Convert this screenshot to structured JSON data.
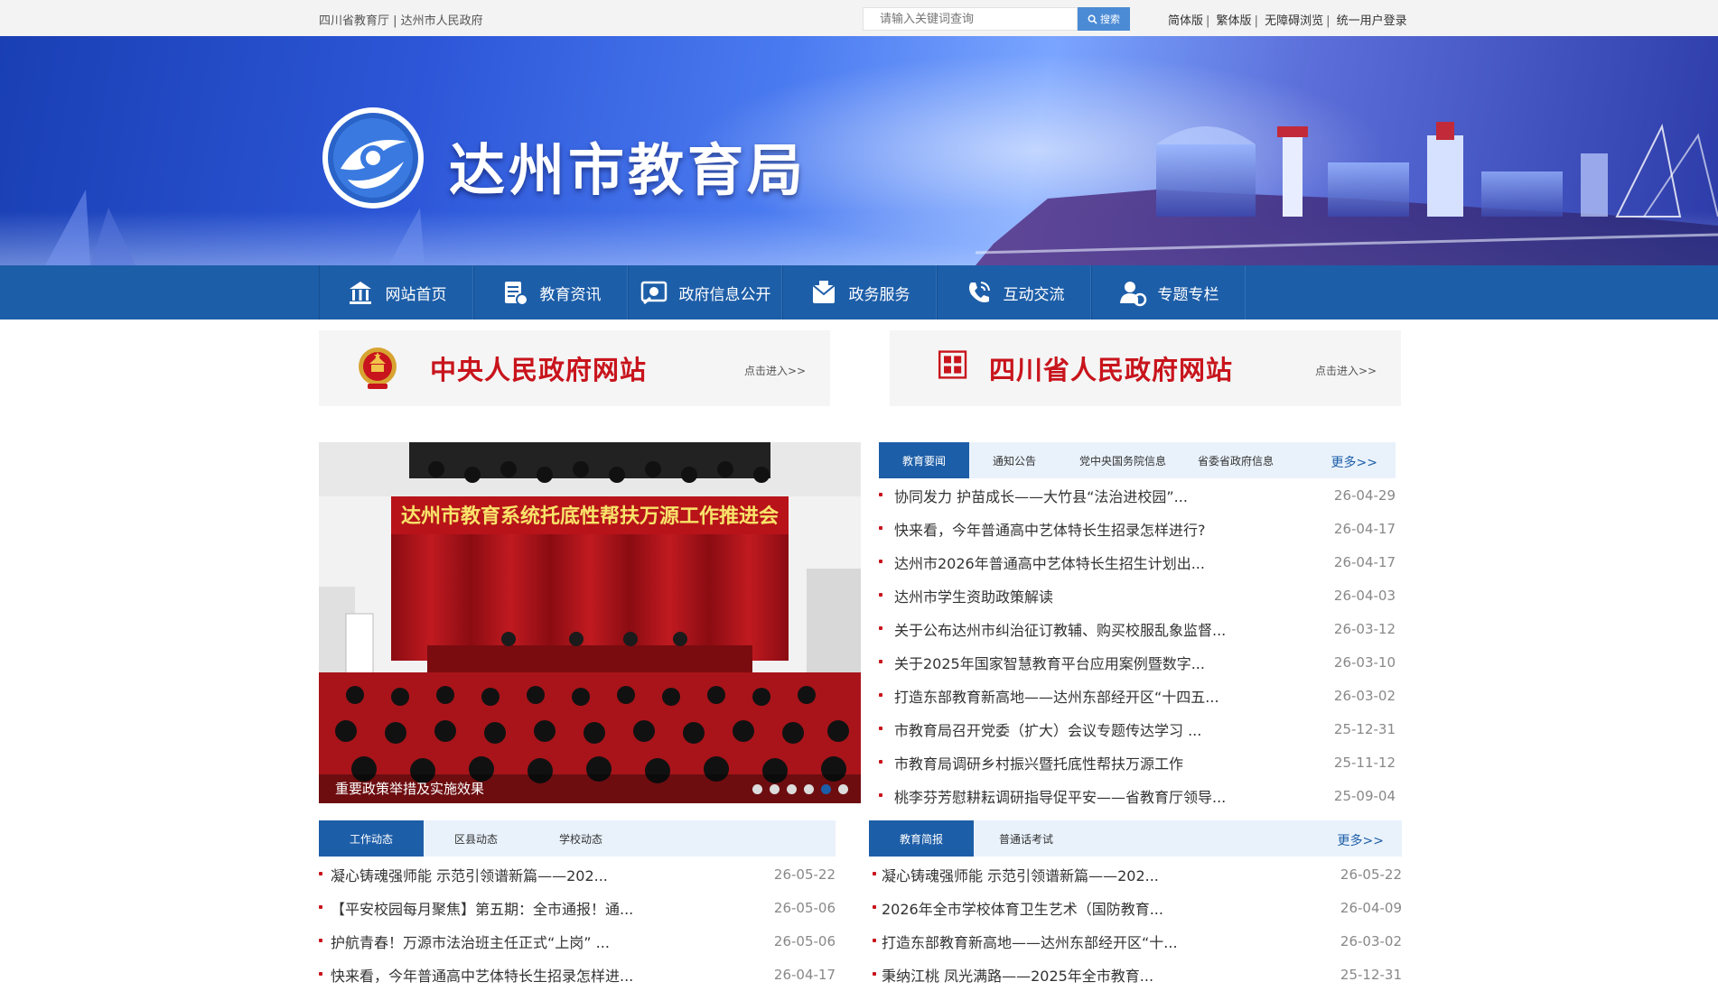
{
  "topbar": {
    "links": "四川省教育厅 | 达州市人民政府",
    "search_placeholder": "请输入关键词查询",
    "search_button": "搜索",
    "right_links": [
      "简体版",
      "繁体版",
      "无障碍浏览",
      "统一用户登录"
    ]
  },
  "banner": {
    "title": "达州市教育局"
  },
  "nav": {
    "items": [
      {
        "label": "网站首页",
        "icon": "home-icon"
      },
      {
        "label": "教育资讯",
        "icon": "news-icon"
      },
      {
        "label": "政府信息公开",
        "icon": "info-icon"
      },
      {
        "label": "政务服务",
        "icon": "service-icon"
      },
      {
        "label": "互动交流",
        "icon": "phone-icon"
      },
      {
        "label": "专题专栏",
        "icon": "user-icon"
      }
    ]
  },
  "gov_banners": {
    "central": {
      "name": "中央人民政府网站",
      "enter": "点击进入>>"
    },
    "sichuan": {
      "name": "四川省人民政府网站",
      "enter": "点击进入>>"
    }
  },
  "slideshow": {
    "caption": "重要政策举措及实施效果",
    "headline": "达州市教育系统托底性帮扶万源工作推进会",
    "dots": 6,
    "active_dot": 5
  },
  "news_top": {
    "tabs": [
      "教育要闻",
      "通知公告",
      "党中央国务院信息",
      "省委省政府信息"
    ],
    "more": "更多>>",
    "items": [
      {
        "title": "协同发力 护苗成长——大竹县“法治进校园”...",
        "date": "26-04-29"
      },
      {
        "title": "快来看，今年普通高中艺体特长生招录怎样进行?",
        "date": "26-04-17"
      },
      {
        "title": "达州市2026年普通高中艺体特长生招生计划出...",
        "date": "26-04-17"
      },
      {
        "title": "达州市学生资助政策解读",
        "date": "26-04-03"
      },
      {
        "title": "关于公布达州市纠治征订教辅、购买校服乱象监督...",
        "date": "26-03-12"
      },
      {
        "title": "关于2025年国家智慧教育平台应用案例暨数字...",
        "date": "26-03-10"
      },
      {
        "title": "打造东部教育新高地——达州东部经开区“十四五...",
        "date": "26-03-02"
      },
      {
        "title": "市教育局召开党委（扩大）会议专题传达学习 ...",
        "date": "25-12-31"
      },
      {
        "title": "市教育局调研乡村振兴暨托底性帮扶万源工作",
        "date": "25-11-12"
      },
      {
        "title": "桃李芬芳慰耕耘调研指导促平安——省教育厅领导...",
        "date": "25-09-04"
      }
    ]
  },
  "news_left": {
    "tabs": [
      "工作动态",
      "区县动态",
      "学校动态"
    ],
    "items": [
      {
        "title": "凝心铸魂强师能 示范引领谱新篇——202...",
        "date": "26-05-22"
      },
      {
        "title": "【平安校园每月聚焦】第五期：全市通报！通...",
        "date": "26-05-06"
      },
      {
        "title": "护航青春！万源市法治班主任正式“上岗” ...",
        "date": "26-05-06"
      },
      {
        "title": "快来看，今年普通高中艺体特长生招录怎样进...",
        "date": "26-04-17"
      }
    ]
  },
  "news_right": {
    "tabs": [
      "教育简报",
      "普通话考试"
    ],
    "more": "更多>>",
    "items": [
      {
        "title": "凝心铸魂强师能 示范引领谱新篇——202...",
        "date": "26-05-22"
      },
      {
        "title": "2026年全市学校体育卫生艺术（国防教育...",
        "date": "26-04-09"
      },
      {
        "title": "打造东部教育新高地——达州东部经开区“十...",
        "date": "26-03-02"
      },
      {
        "title": "秉纳江桃 凤光满路——2025年全市教育...",
        "date": "25-12-31"
      }
    ]
  },
  "colors": {
    "nav": "#1d5ea8",
    "gov_red": "#c8141c",
    "tab_bg": "#e9f2fb"
  }
}
